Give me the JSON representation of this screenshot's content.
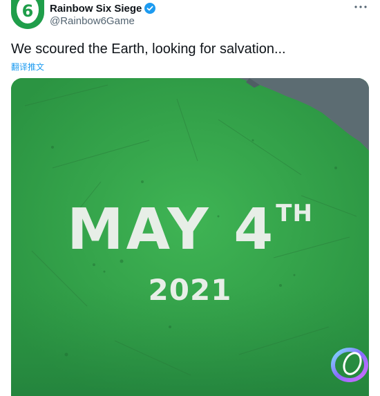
{
  "tweet": {
    "author": {
      "display_name": "Rainbow Six Siege",
      "handle": "@Rainbow6Game",
      "avatar_text": "6",
      "verified": true
    },
    "text": "We scoured the Earth, looking for salvation...",
    "translate_label": "翻译推文",
    "media": {
      "headline": "MAY 4",
      "headline_suffix": "TH",
      "year": "2021"
    }
  },
  "colors": {
    "accent": "#1d9bf0",
    "promo_green": "#33a64a",
    "promo_slate": "#5c6c72"
  },
  "icons": [
    "verified-badge-icon",
    "more-options-icon",
    "watermark-logo-icon"
  ]
}
